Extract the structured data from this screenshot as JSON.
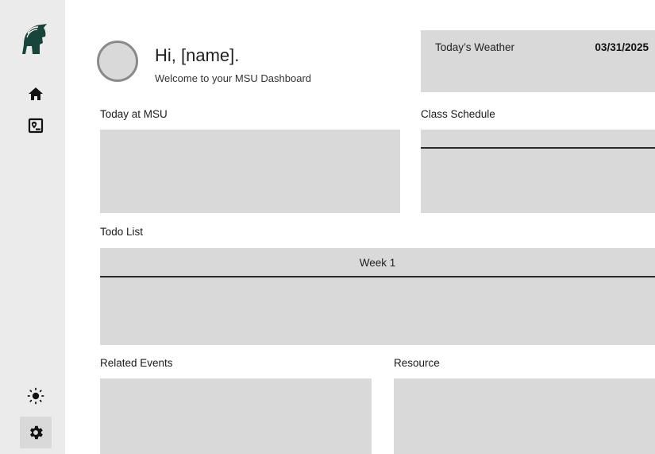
{
  "sidebar": {
    "icons": [
      "spartan-logo-icon",
      "home-icon",
      "map-icon",
      "brightness-icon",
      "settings-icon"
    ],
    "brand_color": "#18453b"
  },
  "header": {
    "greeting": "Hi, [name].",
    "welcome": "Welcome to your MSU Dashboard"
  },
  "weather": {
    "title": "Today’s Weather",
    "date": "03/31/2025"
  },
  "sections": {
    "today": "Today at MSU",
    "class_schedule": "Class Schedule",
    "todo": "Todo List",
    "related_events": "Related Events",
    "resource": "Resource"
  },
  "todo": {
    "week_label": "Week 1"
  },
  "colors": {
    "panel": "#d9d9d9",
    "sidebar": "#ebebeb"
  }
}
